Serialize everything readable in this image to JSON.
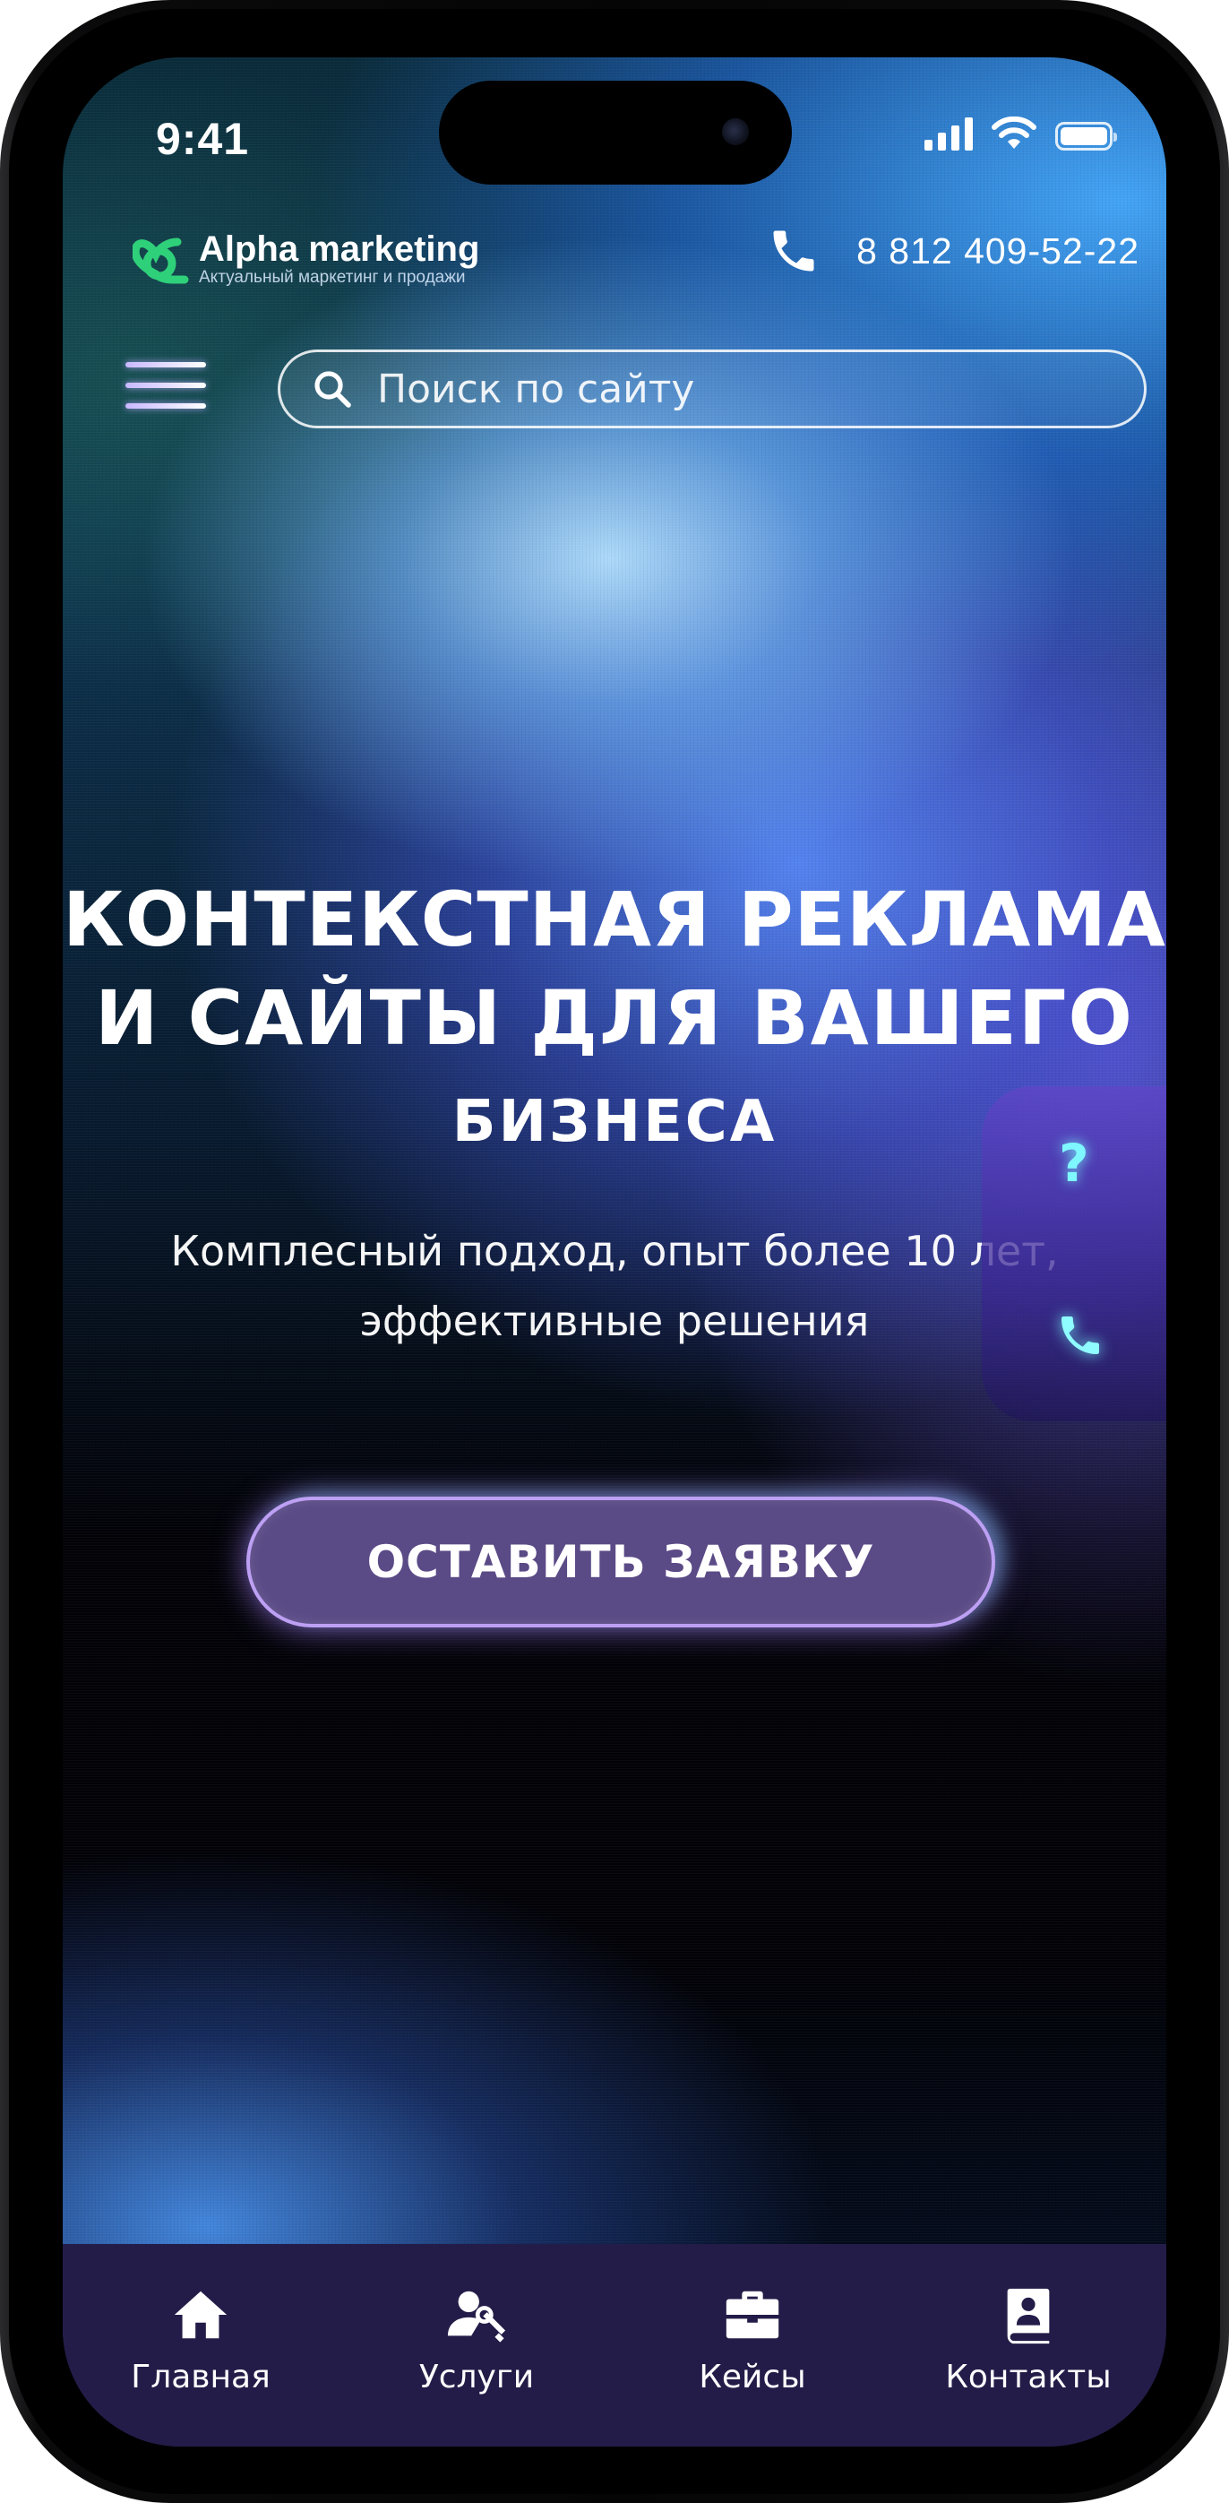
{
  "status_bar": {
    "time": "9:41"
  },
  "header": {
    "logo_name": "Alpha marketing",
    "logo_tagline": "Актуальный маркетинг и продажи",
    "phone": "8 812 409-52-22"
  },
  "search": {
    "placeholder": "Поиск по сайту"
  },
  "hero": {
    "title_line1": "КОНТЕКСТНАЯ РЕКЛАМА",
    "title_line2": "И САЙТЫ ДЛЯ ВАШЕГО",
    "title_line3": "БИЗНЕСА",
    "subtitle_line1": "Комплесный подход, опыт более 10 лет,",
    "subtitle_line2": "эффективные решения",
    "cta_label": "ОСТАВИТЬ ЗАЯВКУ"
  },
  "side_widget": {
    "question_glyph": "?"
  },
  "bottom_nav": {
    "items": [
      {
        "label": "Главная",
        "icon": "home-icon"
      },
      {
        "label": "Услуги",
        "icon": "user-wrench-icon"
      },
      {
        "label": "Кейсы",
        "icon": "briefcase-icon"
      },
      {
        "label": "Контакты",
        "icon": "contact-book-icon"
      }
    ]
  },
  "colors": {
    "accent_cyan": "#7ff7ff",
    "button_fill": "#5a4a86",
    "nav_bg": "#231c48",
    "logo_green": "#2fd07a"
  }
}
